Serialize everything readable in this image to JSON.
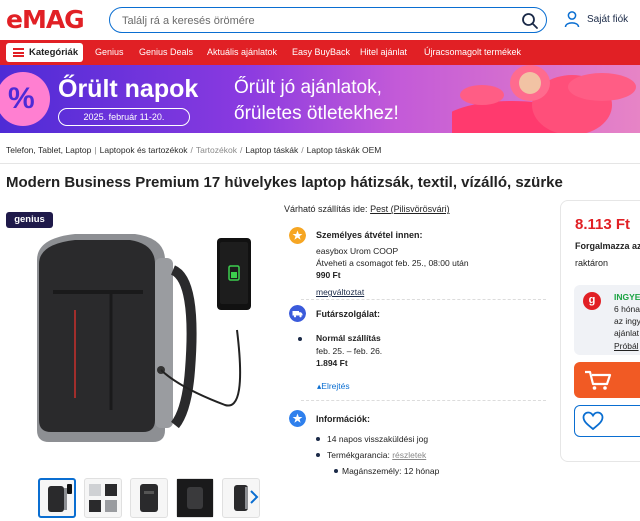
{
  "header": {
    "logo": "eMAG",
    "search_placeholder": "Találj rá a keresés örömére",
    "account_label": "Saját fiók"
  },
  "nav": {
    "categories_label": "Kategóriák",
    "links": [
      "Genius",
      "Genius Deals",
      "Aktuális ajánlatok",
      "Easy BuyBack",
      "Hitel ajánlat",
      "Újracsomagolt termékek"
    ]
  },
  "banner": {
    "percent_symbol": "%",
    "title": "Őrült napok",
    "date": "2025. február 11-20.",
    "tagline_1": "Őrült jó ajánlatok,",
    "tagline_2": "őrületes ötletekhez!"
  },
  "breadcrumb": [
    "Telefon, Tablet, Laptop",
    "Laptopok és tartozékok",
    "Tartozékok",
    "Laptop táskák",
    "Laptop táskák OEM"
  ],
  "product": {
    "title": "Modern Business Premium 17 hüvelykes laptop hátizsák, textil, vízálló, szürke",
    "badge": "genius"
  },
  "shipping": {
    "estimate_label": "Várható szállítás ide:",
    "estimate_location": "Pest (Pilisvörösvári)",
    "pickup_title": "Személyes átvétel innen:",
    "pickup_place": "easybox Urom COOP",
    "pickup_when": "Átveheti a csomagot feb. 25., 08:00 után",
    "pickup_price": "990 Ft",
    "pickup_change": "megváltoztat",
    "courier_title": "Futárszolgálat:",
    "courier_type": "Normál szállítás",
    "courier_dates": "feb. 25. – feb. 26.",
    "courier_price": "1.894 Ft",
    "hide_label": "Elrejtés"
  },
  "info": {
    "title": "Információk:",
    "return": "14 napos visszaküldési jog",
    "warranty_label": "Termékgarancia:",
    "warranty_link": "részletek",
    "warranty_person": "Magánszemély: 12 hónap"
  },
  "buybox": {
    "price": "8.113 Ft",
    "seller": "Forgalmazza az",
    "stock": "raktáron",
    "genius_logo": "g",
    "genius_title": "INGYE",
    "genius_l1": "6 hóna",
    "genius_l2": "az ingy",
    "genius_l3": "ajánlat",
    "genius_try": "Próbál"
  },
  "colors": {
    "brand_red": "#e12025",
    "link_blue": "#0a6ed1",
    "cart_orange": "#f15a24",
    "genius_navy": "#1f1a4a"
  }
}
